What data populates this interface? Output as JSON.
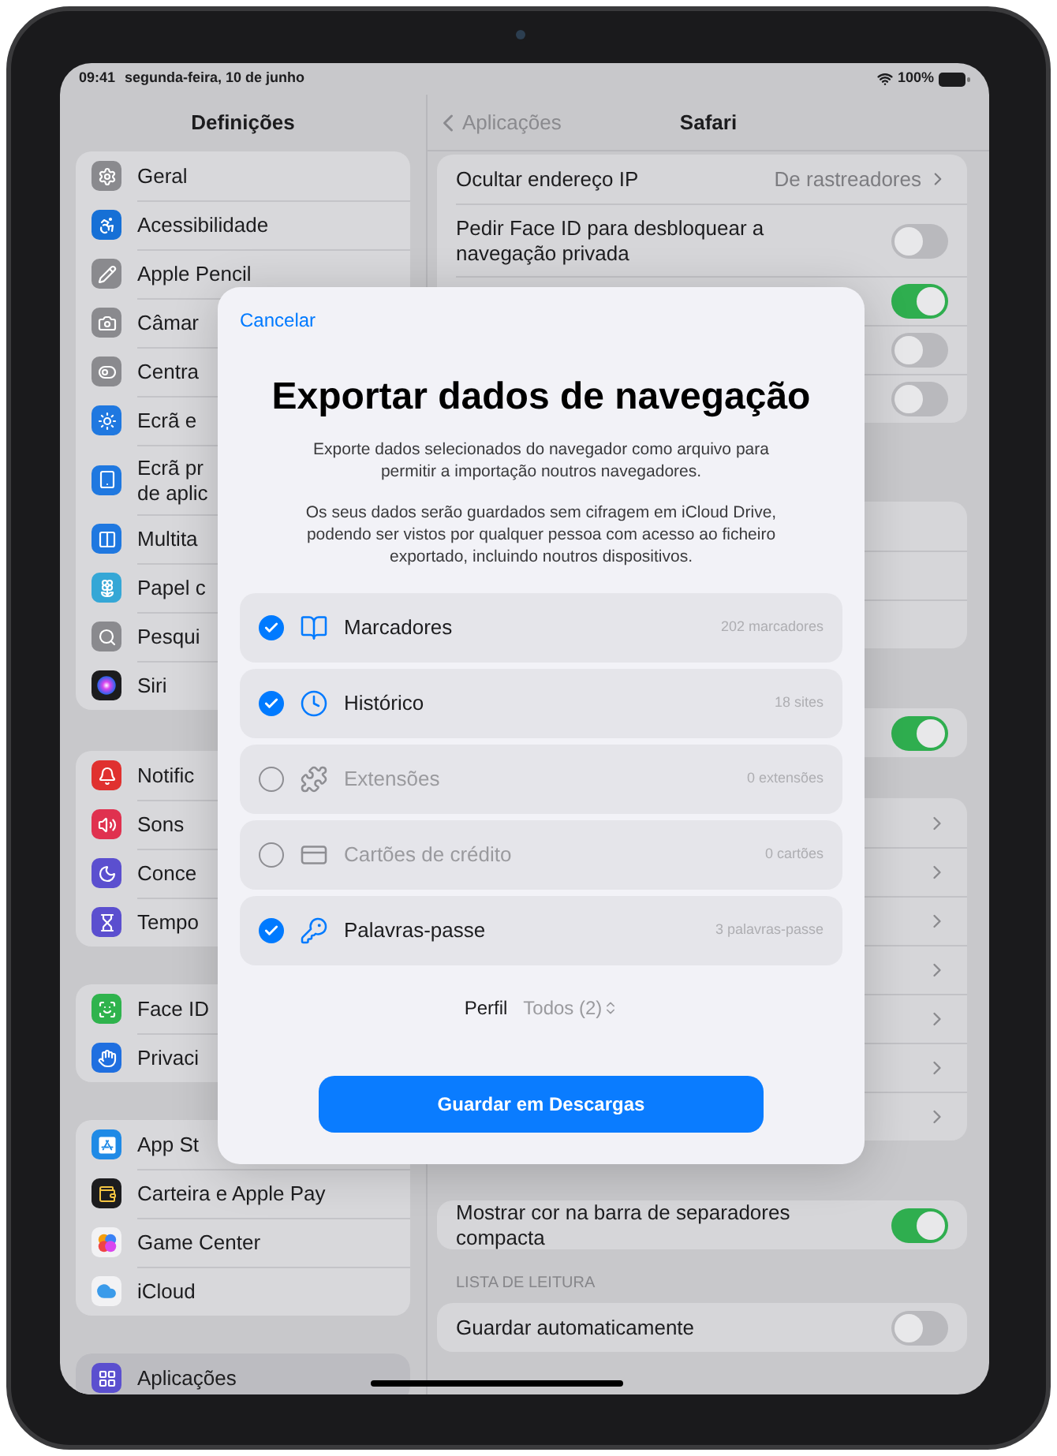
{
  "status_bar": {
    "time": "09:41",
    "date": "segunda-feira, 10 de junho",
    "battery": "100%"
  },
  "sidebar": {
    "title": "Definições",
    "groups": [
      {
        "items": [
          {
            "label": "Geral",
            "color": "#8a8a8e",
            "selected": false
          },
          {
            "label": "Acessibilidade",
            "color": "#1670d6",
            "selected": false
          },
          {
            "label": "Apple Pencil",
            "color": "#8a8a8e",
            "selected": false
          },
          {
            "label": "Câmar",
            "color": "#8a8a8e",
            "selected": false
          },
          {
            "label": "Centra",
            "color": "#8a8a8e",
            "selected": false
          },
          {
            "label": "Ecrã e",
            "color": "#1f78e0",
            "selected": false
          },
          {
            "lines": [
              "Ecrã pr",
              "de aplic"
            ],
            "color": "#1f78e0",
            "selected": false
          },
          {
            "label": "Multita",
            "color": "#1f78e0",
            "selected": false
          },
          {
            "label": "Papel c",
            "color": "#35a7d6",
            "selected": false
          },
          {
            "label": "Pesqui",
            "color": "#8a8a8e",
            "selected": false
          },
          {
            "label": "Siri",
            "color": "#1c1c1e",
            "selected": false
          }
        ]
      },
      {
        "items": [
          {
            "label": "Notific",
            "color": "#e0312f",
            "selected": false
          },
          {
            "label": "Sons",
            "color": "#e0314f",
            "selected": false
          },
          {
            "label": "Conce",
            "color": "#5b4fcf",
            "selected": false
          },
          {
            "label": "Tempo",
            "color": "#5b4fcf",
            "selected": false
          }
        ]
      },
      {
        "items": [
          {
            "label": "Face ID",
            "color": "#2fb34d",
            "selected": false
          },
          {
            "label": "Privaci",
            "color": "#1f6fe0",
            "selected": false
          }
        ]
      },
      {
        "items": [
          {
            "label": "App St",
            "color": "#1f8ae6",
            "selected": false
          },
          {
            "label": "Carteira e Apple Pay",
            "color": "#1c1c1e",
            "selected": false
          },
          {
            "label": "Game Center",
            "color": "#f2f2f4",
            "selected": false
          },
          {
            "label": "iCloud",
            "color": "#f2f2f4",
            "selected": false
          }
        ]
      },
      {
        "items": [
          {
            "label": "Aplicações",
            "color": "#5b4fcf",
            "selected": true
          }
        ]
      }
    ]
  },
  "detail": {
    "back": "Aplicações",
    "title": "Safari",
    "sections": [
      {
        "rows": [
          {
            "kind": "value",
            "label": "Ocultar endereço IP",
            "value": "De rastreadores"
          },
          {
            "kind": "toggle",
            "label": "Pedir Face ID para desbloquear a navegação privada",
            "on": false
          },
          {
            "kind": "toggle",
            "on": true
          },
          {
            "kind": "toggle",
            "on": false
          },
          {
            "kind": "toggle",
            "on": false
          }
        ]
      },
      {
        "rows": [
          {
            "kind": "blank"
          },
          {
            "kind": "blank"
          },
          {
            "kind": "blank"
          }
        ]
      },
      {
        "rows": [
          {
            "kind": "toggle",
            "on": true
          }
        ]
      },
      {
        "rows": [
          {
            "kind": "chevron"
          },
          {
            "kind": "chevron"
          },
          {
            "kind": "chevron"
          },
          {
            "kind": "chevron"
          },
          {
            "kind": "chevron"
          },
          {
            "kind": "chevron"
          },
          {
            "kind": "chevron"
          }
        ]
      },
      {
        "rows": [
          {
            "kind": "toggle",
            "label": "Mostrar cor na barra de separadores compacta",
            "on": true
          }
        ]
      },
      {
        "header": "LISTA DE LEITURA",
        "rows": [
          {
            "kind": "toggle",
            "label": "Guardar automaticamente",
            "on": false
          }
        ]
      }
    ]
  },
  "modal": {
    "cancel": "Cancelar",
    "title": "Exportar dados de navegação",
    "paragraphs": [
      "Exporte dados selecionados do navegador como arquivo para permitir a importação noutros navegadores.",
      "Os seus dados serão guardados sem cifragem em iCloud Drive, podendo ser vistos por qualquer pessoa com acesso ao ficheiro exportado, incluindo noutros dispositivos."
    ],
    "options": [
      {
        "label": "Marcadores",
        "count": "202 marcadores",
        "checked": true,
        "disabled": false
      },
      {
        "label": "Histórico",
        "count": "18 sites",
        "checked": true,
        "disabled": false
      },
      {
        "label": "Extensões",
        "count": "0 extensões",
        "checked": false,
        "disabled": true
      },
      {
        "label": "Cartões de crédito",
        "count": "0 cartões",
        "checked": false,
        "disabled": true
      },
      {
        "label": "Palavras-passe",
        "count": "3 palavras-passe",
        "checked": true,
        "disabled": false
      }
    ],
    "profile_label": "Perfil",
    "profile_value": "Todos (2)",
    "button": "Guardar em Descargas"
  }
}
